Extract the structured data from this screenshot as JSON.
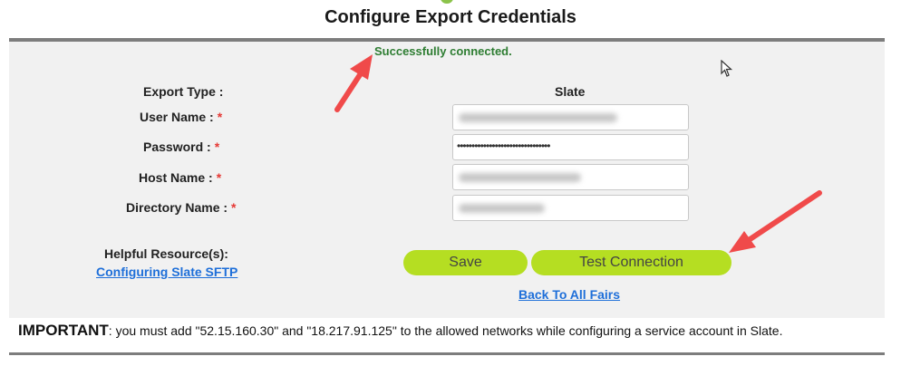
{
  "header": {
    "title": "Configure Export Credentials"
  },
  "status": {
    "message": "Successfully connected."
  },
  "form": {
    "export_type_label": "Export Type :",
    "export_type_value": "Slate",
    "user_name_label": "User Name :",
    "password_label": "Password :",
    "password_value": "••••••••••••••••••••••••••••••••",
    "host_name_label": "Host Name :",
    "directory_name_label": "Directory Name :",
    "required_marker": "*"
  },
  "resources": {
    "label": "Helpful Resource(s):",
    "link": "Configuring Slate SFTP"
  },
  "actions": {
    "save": "Save",
    "test_connection": "Test Connection",
    "back": "Back To All Fairs"
  },
  "notice": {
    "prefix": "IMPORTANT",
    "text": ": you must add \"52.15.160.30\" and \"18.217.91.125\" to the allowed networks  while configuring a service account in Slate."
  },
  "colors": {
    "accent": "#b5de22",
    "success": "#2e7d32",
    "required": "#e53935",
    "link": "#1e6fd9",
    "annotation_arrow": "#f04a4a"
  }
}
